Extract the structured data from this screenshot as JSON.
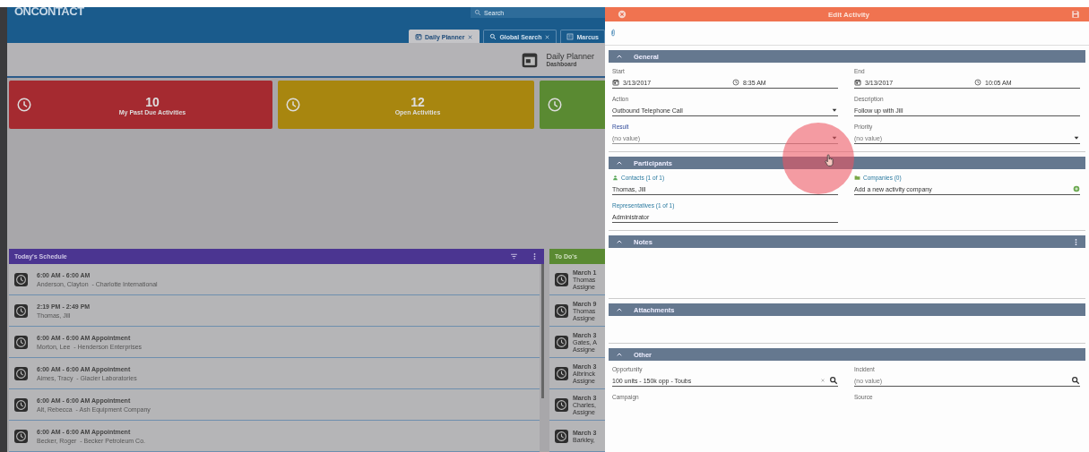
{
  "app": {
    "logo": "ONCONTACT",
    "search": {
      "placeholder": "Search"
    },
    "tabs": [
      {
        "label": "Daily Planner",
        "closable": true,
        "selected": true
      },
      {
        "label": "Global Search",
        "closable": true,
        "selected": false
      },
      {
        "label": "Marcus",
        "closable": false,
        "selected": false
      }
    ]
  },
  "page_header": {
    "title": "Daily Planner",
    "subtitle": "Dashboard"
  },
  "tiles": [
    {
      "count": "10",
      "label": "My Past Due Activities",
      "color": "#a52a30"
    },
    {
      "count": "12",
      "label": "Open Activities",
      "color": "#a8860f"
    },
    {
      "color": "#5a8a32"
    }
  ],
  "schedule": {
    "title": "Today's Schedule",
    "rows": [
      {
        "time": "6:00 AM - 6:00 AM",
        "detail": "Anderson, Clayton  - Charlotte International"
      },
      {
        "time": "2:19 PM - 2:49 PM",
        "detail": "Thomas, Jill"
      },
      {
        "time": "6:00 AM - 6:00 AM Appointment",
        "detail": "Morton, Lee  - Henderson Enterprises"
      },
      {
        "time": "6:00 AM - 6:00 AM Appointment",
        "detail": "Aimes, Tracy  - Glacier Laboratories"
      },
      {
        "time": "6:00 AM - 6:00 AM Appointment",
        "detail": "Alt, Rebecca  - Ash Equipment Company"
      },
      {
        "time": "6:00 AM - 6:00 AM Appointment",
        "detail": "Becker, Roger  - Becker Petroleum Co."
      }
    ]
  },
  "todos": {
    "title": "To Do's",
    "items": [
      {
        "lines": [
          "March 1",
          "Thomas",
          "Assigne"
        ]
      },
      {
        "lines": [
          "March 9",
          "Thomas",
          "Assigne"
        ]
      },
      {
        "lines": [
          "March 3",
          "Gates, A",
          "Assigne"
        ]
      },
      {
        "lines": [
          "March 3",
          "Albrinck",
          "Assigne"
        ]
      },
      {
        "lines": [
          "March 3",
          "Charles,",
          "Assigne"
        ]
      },
      {
        "lines": [
          "March 3",
          "Barkley,"
        ]
      }
    ]
  },
  "edit_activity": {
    "title": "Edit Activity",
    "sections": [
      {
        "title": "General",
        "expanded": true,
        "menu": false,
        "fields": [
          {
            "kind": "datetime",
            "label": "Start",
            "date": "3/13/2017",
            "time": "8:35 AM"
          },
          {
            "kind": "datetime",
            "label": "End",
            "date": "3/13/2017",
            "time": "10:05 AM"
          },
          {
            "kind": "dropdown",
            "label": "Action",
            "value": "Outbound Telephone Call",
            "focused": false
          },
          {
            "kind": "text",
            "label": "Description",
            "value": "Follow up with Jill"
          },
          {
            "kind": "dropdown",
            "label": "Result",
            "placeholder": "(no value)",
            "focused": true
          },
          {
            "kind": "dropdown",
            "label": "Priority",
            "placeholder": "(no value)",
            "focused": false
          }
        ]
      },
      {
        "title": "Participants",
        "expanded": true,
        "menu": false,
        "fields": [
          {
            "kind": "link",
            "label": "Contacts (1 of 1)",
            "value": "Thomas, Jill"
          },
          {
            "kind": "link",
            "label": "Companies (0)",
            "value": "Add a new activity company",
            "add": true
          },
          {
            "kind": "link",
            "label": "Representatives (1 of 1)",
            "value": "Administrator"
          }
        ]
      },
      {
        "title": "Notes",
        "expanded": true,
        "menu": true
      },
      {
        "title": "Attachments",
        "expanded": true,
        "menu": false
      },
      {
        "title": "Other",
        "expanded": true,
        "menu": false,
        "fields": [
          {
            "kind": "lookup",
            "label": "Opportunity",
            "value": "100 units - 150k opp - Toubs",
            "clearable": true
          },
          {
            "kind": "lookup",
            "label": "Incident",
            "placeholder": "(no value)",
            "clearable": false
          },
          {
            "kind": "text",
            "label": "Campaign"
          },
          {
            "kind": "text",
            "label": "Source"
          }
        ]
      }
    ]
  }
}
